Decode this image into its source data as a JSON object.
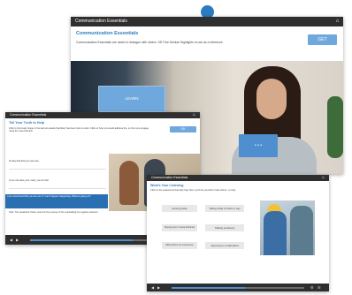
{
  "main_window": {
    "title": "Communication Essentials",
    "home_icon": "home-icon",
    "heading": "Communication Essentials",
    "description": "Communication Essentials are useful in dialogue with others. GET the Module Highlights to use as a reference.",
    "get_label": "GET",
    "learn_label": "LEARN",
    "dots_label": "• • •"
  },
  "left_window": {
    "title": "Communication Essentials",
    "heading": "Tell Your Truth to Help",
    "instructions": "Click to the lovely house in the last two weeks that likely has been here to work. Click on how you would address the, so the more engage using the essential skill.",
    "ok_label": "OK",
    "options": [
      "Its day that that you can see.",
      "If you can take your mind, you do that.",
      "I am concerned that you are not. If I can't happen happening. What is going on?"
    ],
    "feedback": "Click: The situational choice connects the purpose of the use/leading the negative behavior.",
    "progress": 0.68
  },
  "right_window": {
    "title": "Communication Essentials",
    "heading": "What's Your Listening",
    "instructions": "Click on the statements that help help them you'll do yourself to help others - to help.",
    "options": [
      "Giving praise",
      "Telling what to think or say",
      "Staying quiet or being distracted",
      "Talking positively",
      "Talking about our experiences",
      "Agreeing to understand"
    ],
    "progress": 0.55
  },
  "colors": {
    "accent": "#2b7bc0",
    "button": "#6fa8dc",
    "titlebar": "#2f2f2f"
  }
}
